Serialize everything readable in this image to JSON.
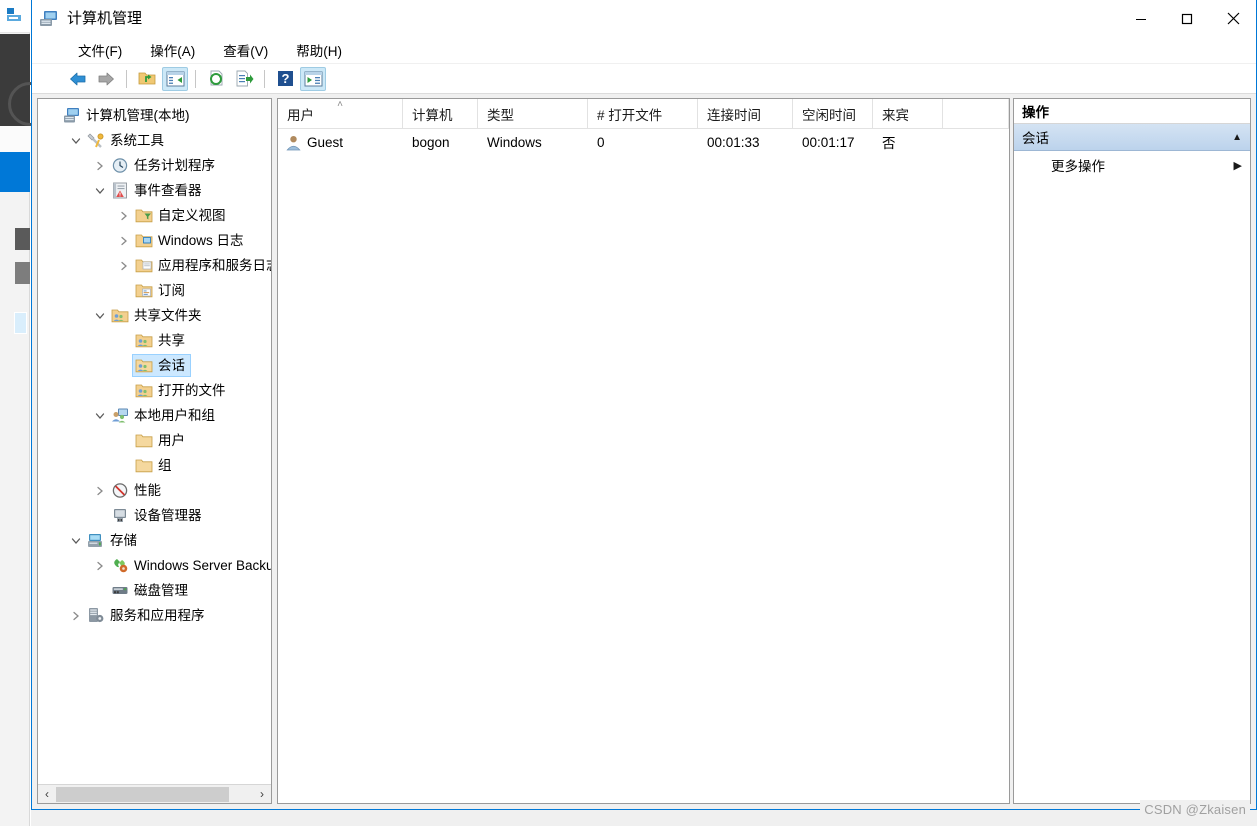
{
  "window": {
    "title": "计算机管理",
    "icon": "computer-management-icon",
    "minimize_label": "—",
    "maximize_label": "☐",
    "close_label": "✕"
  },
  "menubar": {
    "items": [
      {
        "label": "文件(F)",
        "name": "menu-file"
      },
      {
        "label": "操作(A)",
        "name": "menu-action"
      },
      {
        "label": "查看(V)",
        "name": "menu-view"
      },
      {
        "label": "帮助(H)",
        "name": "menu-help"
      }
    ]
  },
  "toolbar": {
    "buttons": [
      {
        "name": "back-button",
        "icon": "arrow-left-icon",
        "active": false
      },
      {
        "name": "forward-button",
        "icon": "arrow-right-icon",
        "active": false
      },
      {
        "name": "up-one-level-button",
        "icon": "folder-up-icon",
        "active": false
      },
      {
        "name": "show-hide-tree-button",
        "icon": "console-tree-icon",
        "active": true
      },
      {
        "name": "refresh-button",
        "icon": "refresh-icon",
        "active": false
      },
      {
        "name": "export-list-button",
        "icon": "export-list-icon",
        "active": false
      },
      {
        "name": "help-button",
        "icon": "question-mark-icon",
        "active": false
      },
      {
        "name": "show-hide-action-pane-button",
        "icon": "action-pane-icon",
        "active": true
      }
    ]
  },
  "tree": {
    "nodes": [
      {
        "label": "计算机管理(本地)",
        "indent": 0,
        "expander": "",
        "icon": "computer-icon",
        "selected": false
      },
      {
        "label": "系统工具",
        "indent": 1,
        "expander": "v",
        "icon": "system-tools-icon",
        "selected": false
      },
      {
        "label": "任务计划程序",
        "indent": 2,
        "expander": ">",
        "icon": "clock-icon",
        "selected": false
      },
      {
        "label": "事件查看器",
        "indent": 2,
        "expander": "v",
        "icon": "event-viewer-icon",
        "selected": false
      },
      {
        "label": "自定义视图",
        "indent": 3,
        "expander": ">",
        "icon": "custom-views-folder-icon",
        "selected": false
      },
      {
        "label": "Windows 日志",
        "indent": 3,
        "expander": ">",
        "icon": "windows-logs-folder-icon",
        "selected": false
      },
      {
        "label": "应用程序和服务日志",
        "indent": 3,
        "expander": ">",
        "icon": "app-service-logs-folder-icon",
        "selected": false
      },
      {
        "label": "订阅",
        "indent": 3,
        "expander": "",
        "icon": "subscriptions-folder-icon",
        "selected": false
      },
      {
        "label": "共享文件夹",
        "indent": 2,
        "expander": "v",
        "icon": "shared-folders-icon",
        "selected": false
      },
      {
        "label": "共享",
        "indent": 3,
        "expander": "",
        "icon": "shares-icon",
        "selected": false
      },
      {
        "label": "会话",
        "indent": 3,
        "expander": "",
        "icon": "sessions-icon",
        "selected": true
      },
      {
        "label": "打开的文件",
        "indent": 3,
        "expander": "",
        "icon": "open-files-icon",
        "selected": false
      },
      {
        "label": "本地用户和组",
        "indent": 2,
        "expander": "v",
        "icon": "local-users-groups-icon",
        "selected": false
      },
      {
        "label": "用户",
        "indent": 3,
        "expander": "",
        "icon": "folder-icon",
        "selected": false
      },
      {
        "label": "组",
        "indent": 3,
        "expander": "",
        "icon": "folder-icon",
        "selected": false
      },
      {
        "label": "性能",
        "indent": 2,
        "expander": ">",
        "icon": "performance-icon",
        "selected": false
      },
      {
        "label": "设备管理器",
        "indent": 2,
        "expander": "",
        "icon": "device-manager-icon",
        "selected": false
      },
      {
        "label": "存储",
        "indent": 1,
        "expander": "v",
        "icon": "storage-icon",
        "selected": false
      },
      {
        "label": "Windows Server Backup",
        "indent": 2,
        "expander": ">",
        "icon": "server-backup-icon",
        "selected": false
      },
      {
        "label": "磁盘管理",
        "indent": 2,
        "expander": "",
        "icon": "disk-management-icon",
        "selected": false
      },
      {
        "label": "服务和应用程序",
        "indent": 1,
        "expander": ">",
        "icon": "services-apps-icon",
        "selected": false
      }
    ],
    "scrollbar": {
      "left_arrow": "‹",
      "right_arrow": "›"
    }
  },
  "list": {
    "sort_column": "用户",
    "sort_caret": "˄",
    "columns": [
      {
        "label": "用户",
        "key": "c-user",
        "sorted": true
      },
      {
        "label": "计算机",
        "key": "c-comp",
        "sorted": false
      },
      {
        "label": "类型",
        "key": "c-type",
        "sorted": false
      },
      {
        "label": "# 打开文件",
        "key": "c-open",
        "sorted": false
      },
      {
        "label": "连接时间",
        "key": "c-conn",
        "sorted": false
      },
      {
        "label": "空闲时间",
        "key": "c-idle",
        "sorted": false
      },
      {
        "label": "来宾",
        "key": "c-guest",
        "sorted": false
      }
    ],
    "rows": [
      {
        "icon": "user-icon",
        "user": "Guest",
        "computer": "bogon",
        "type": "Windows",
        "open_files": "0",
        "connected_time": "00:01:33",
        "idle_time": "00:01:17",
        "guest": "否"
      }
    ]
  },
  "actions": {
    "title": "操作",
    "group": {
      "label": "会话",
      "collapse_caret": "▲"
    },
    "items": [
      {
        "label": "更多操作",
        "caret": "▶",
        "name": "more-actions-item"
      }
    ]
  },
  "watermark": {
    "text": "CSDN @Zkaisen"
  },
  "colors": {
    "window_border": "#0078d7",
    "selection": "#cce8ff",
    "action_group": "#bcd3ec",
    "toolbar_active": "#cce8f7"
  }
}
